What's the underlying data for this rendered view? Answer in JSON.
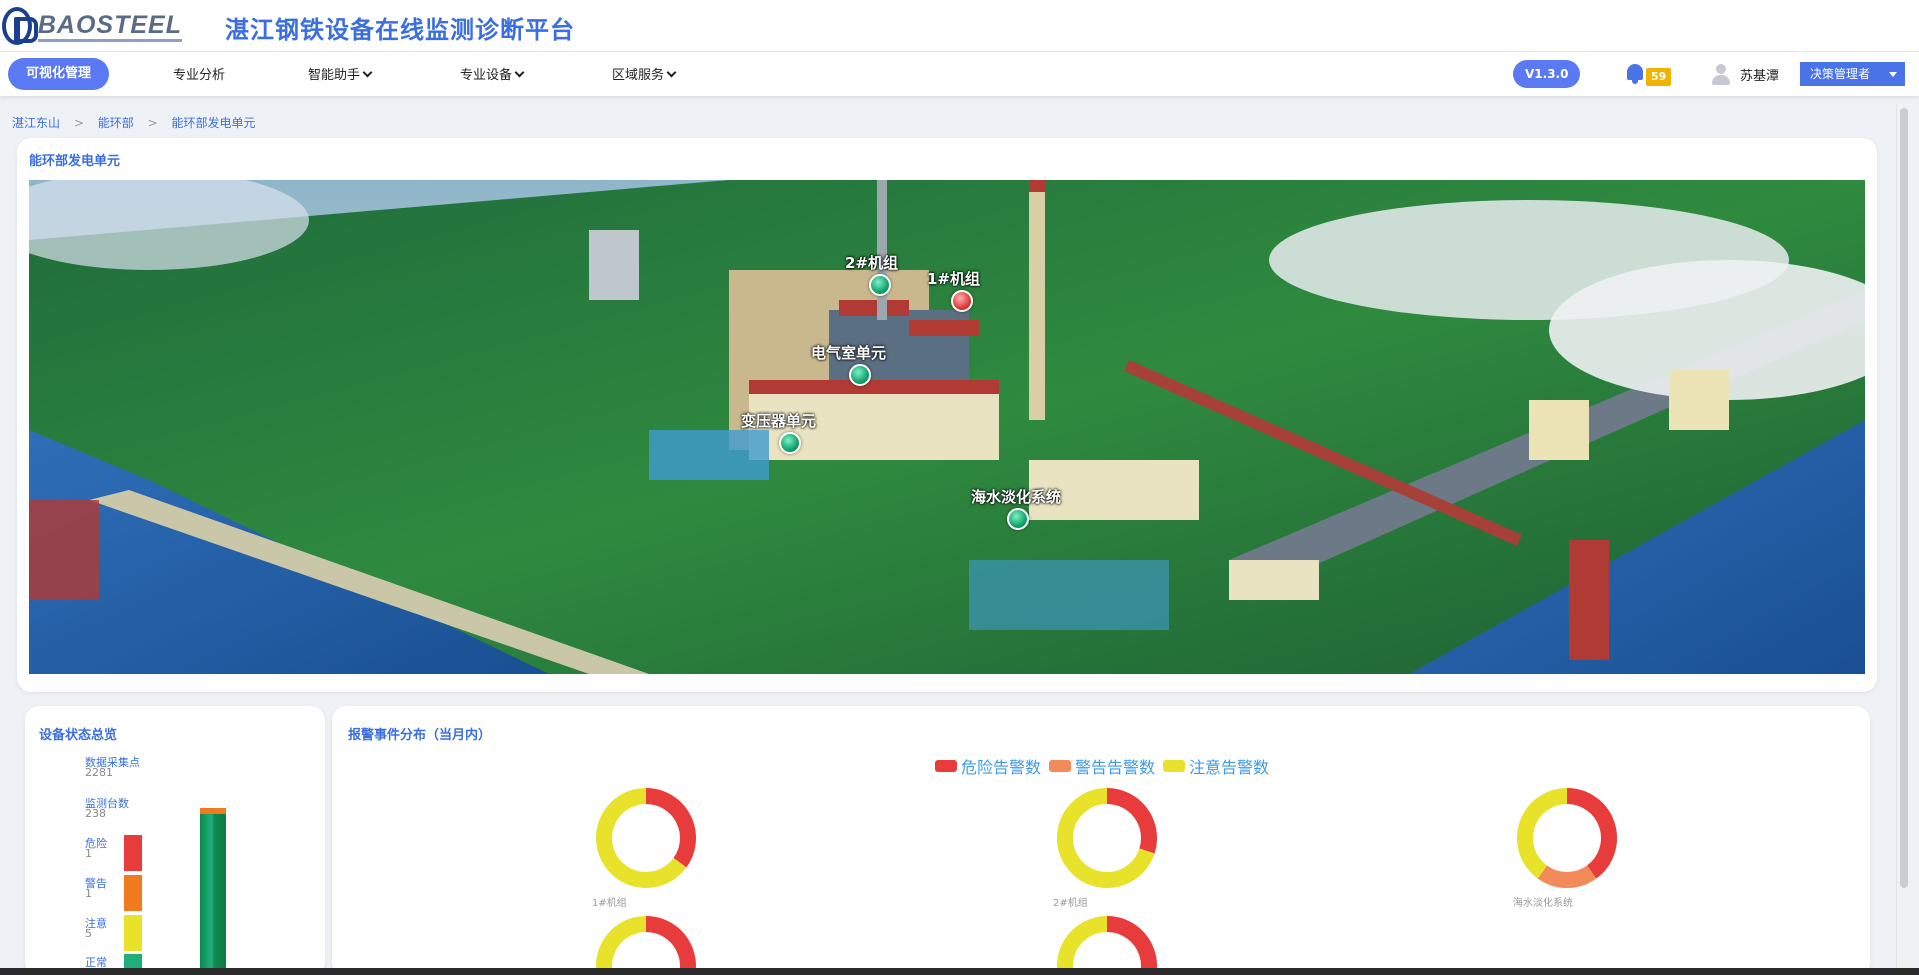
{
  "header": {
    "logo_text": "BAOSTEEL",
    "app_title": "湛江钢铁设备在线监测诊断平台"
  },
  "nav": {
    "items": [
      {
        "label": "可视化管理",
        "active": true,
        "dropdown": false
      },
      {
        "label": "专业分析",
        "active": false,
        "dropdown": false
      },
      {
        "label": "智能助手",
        "active": false,
        "dropdown": true
      },
      {
        "label": "专业设备",
        "active": false,
        "dropdown": true
      },
      {
        "label": "区域服务",
        "active": false,
        "dropdown": true
      }
    ],
    "version": "V1.3.0",
    "notification_count": "59",
    "username": "苏基潭",
    "role": "决策管理者"
  },
  "breadcrumb": [
    "湛江东山",
    ">",
    "能环部",
    ">",
    "能环部发电单元"
  ],
  "scene_panel": {
    "title": "能环部发电单元",
    "markers": [
      {
        "label": "2#机组",
        "status": "green"
      },
      {
        "label": "1#机组",
        "status": "red"
      },
      {
        "label": "电气室单元",
        "status": "green"
      },
      {
        "label": "变压器单元",
        "status": "green"
      },
      {
        "label": "海水淡化系统",
        "status": "green"
      }
    ]
  },
  "status_panel": {
    "title": "设备状态总览",
    "data_points_label": "数据采集点",
    "data_points_value": "2281",
    "monitored_label": "监测台数",
    "monitored_value": "238",
    "levels": [
      {
        "label": "危险",
        "value": "1",
        "color": "#e83b3b"
      },
      {
        "label": "警告",
        "value": "1",
        "color": "#f07a1e"
      },
      {
        "label": "注意",
        "value": "5",
        "color": "#e8e22a"
      },
      {
        "label": "正常",
        "value": "",
        "color": "#1fb07a"
      }
    ]
  },
  "alarm_panel": {
    "title": "报警事件分布（当月内）",
    "legend": [
      {
        "label": "危险告警数",
        "color": "#e83b3b"
      },
      {
        "label": "警告告警数",
        "color": "#f28a5a"
      },
      {
        "label": "注意告警数",
        "color": "#e8e22a"
      }
    ]
  },
  "chart_data": {
    "type": "pie",
    "title": "报警事件分布（当月内）",
    "series_names": [
      "危险告警数",
      "警告告警数",
      "注意告警数"
    ],
    "charts": [
      {
        "name": "1#机组",
        "values": [
          35,
          0,
          65
        ]
      },
      {
        "name": "2#机组",
        "values": [
          30,
          0,
          70
        ]
      },
      {
        "name": "海水淡化系统",
        "values": [
          40,
          20,
          40
        ]
      },
      {
        "name": "",
        "values": [
          35,
          0,
          65
        ]
      },
      {
        "name": "",
        "values": [
          40,
          0,
          60
        ]
      }
    ]
  }
}
